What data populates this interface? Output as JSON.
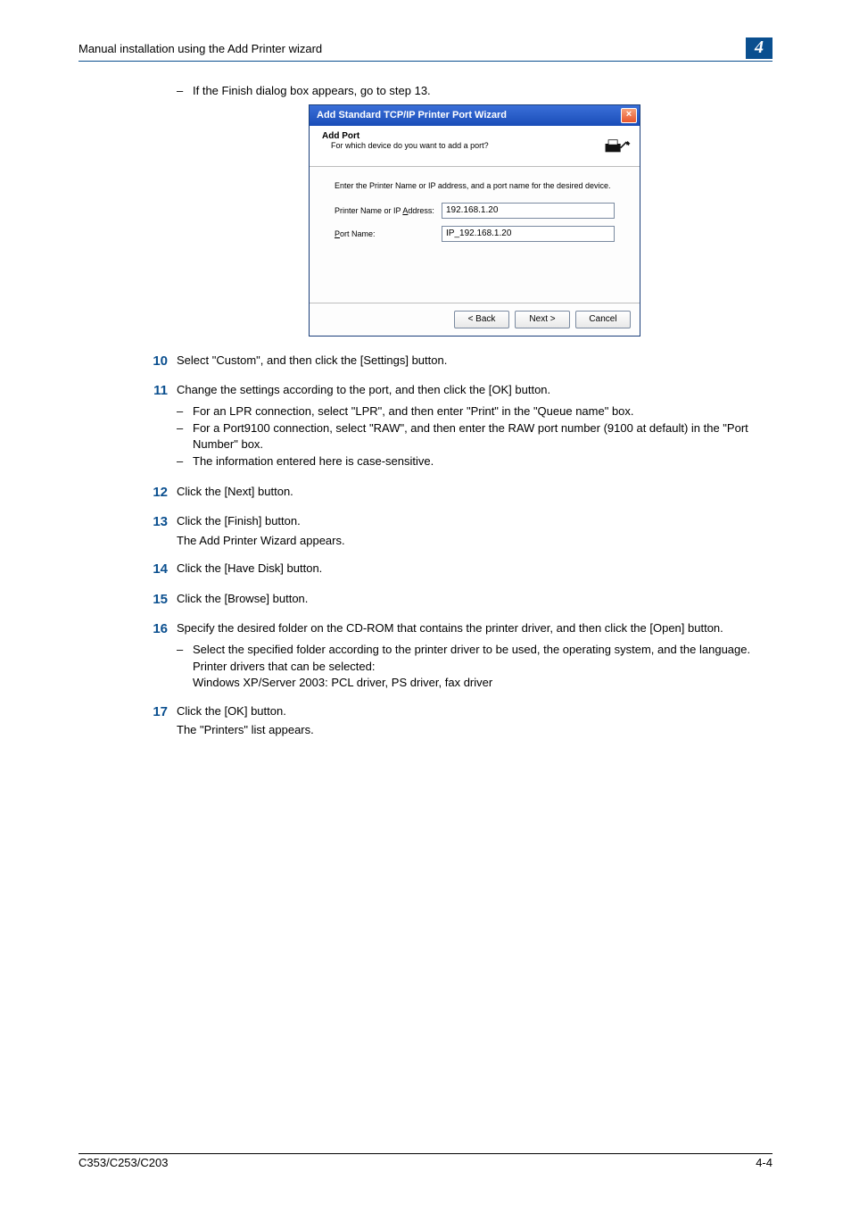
{
  "header": {
    "title": "Manual installation using the Add Printer wizard",
    "chapter": "4"
  },
  "intro_bullet": "If the Finish dialog box appears, go to step 13.",
  "dialog": {
    "title": "Add Standard TCP/IP Printer Port Wizard",
    "close": "×",
    "head_title": "Add Port",
    "head_sub": "For which device do you want to add a port?",
    "instruction": "Enter the Printer Name or IP address, and a port name for the desired device.",
    "field1_label_pre": "Printer Name or IP ",
    "field1_label_ul": "A",
    "field1_label_post": "ddress:",
    "field1_value": "192.168.1.20",
    "field2_label_ul": "P",
    "field2_label_post": "ort Name:",
    "field2_value": "IP_192.168.1.20",
    "btn_back": "< Back",
    "btn_next": "Next >",
    "btn_cancel": "Cancel"
  },
  "steps": {
    "s10": {
      "num": "10",
      "text": "Select \"Custom\", and then click the [Settings] button."
    },
    "s11": {
      "num": "11",
      "text": "Change the settings according to the port, and then click the [OK] button.",
      "b1": "For an LPR connection, select \"LPR\", and then enter \"Print\" in the \"Queue name\" box.",
      "b2": "For a Port9100 connection, select \"RAW\", and then enter the RAW port number (9100 at default) in the \"Port Number\" box.",
      "b3": "The information entered here is case-sensitive."
    },
    "s12": {
      "num": "12",
      "text": "Click the [Next] button."
    },
    "s13": {
      "num": "13",
      "text": "Click the [Finish] button.",
      "para": "The Add Printer Wizard appears."
    },
    "s14": {
      "num": "14",
      "text": "Click the [Have Disk] button."
    },
    "s15": {
      "num": "15",
      "text": "Click the [Browse] button."
    },
    "s16": {
      "num": "16",
      "text": "Specify the desired folder on the CD-ROM that contains the printer driver, and then click the [Open] button.",
      "b1": "Select the specified folder according to the printer driver to be used, the operating system, and the language.",
      "l1": "Printer drivers that can be selected:",
      "l2": "Windows XP/Server 2003: PCL driver, PS driver, fax driver"
    },
    "s17": {
      "num": "17",
      "text": "Click the [OK] button.",
      "para": "The \"Printers\" list appears."
    }
  },
  "footer": {
    "left": "C353/C253/C203",
    "right": "4-4"
  }
}
